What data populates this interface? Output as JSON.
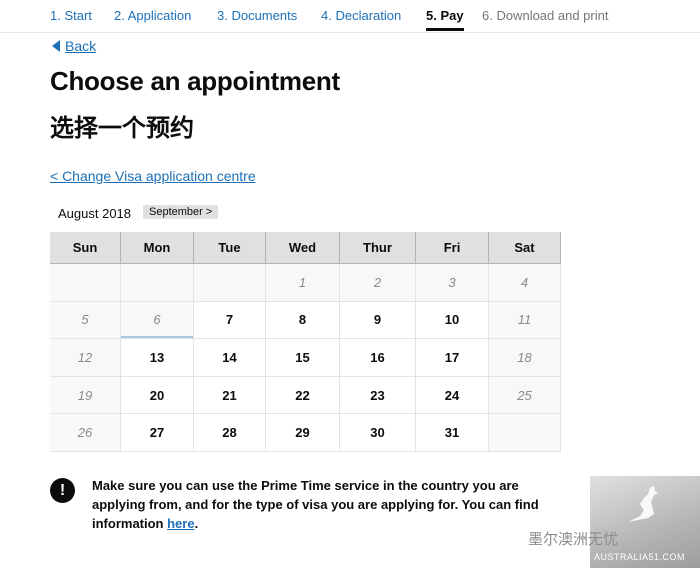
{
  "steps": [
    {
      "label": "1. Start",
      "state": "link"
    },
    {
      "label": "2. Application",
      "state": "link"
    },
    {
      "label": "3. Documents",
      "state": "link"
    },
    {
      "label": "4. Declaration",
      "state": "link"
    },
    {
      "label": "5. Pay",
      "state": "current"
    },
    {
      "label": "6. Download and print",
      "state": "disabled"
    }
  ],
  "back_label": "Back",
  "page_title": "Choose an appointment",
  "page_subtitle": "选择一个预约",
  "change_centre_label": "< Change Visa application centre",
  "calendar": {
    "month_label": "August 2018",
    "next_month_label": "September >",
    "day_headers": [
      "Sun",
      "Mon",
      "Tue",
      "Wed",
      "Thur",
      "Fri",
      "Sat"
    ],
    "weeks": [
      [
        "",
        "",
        "",
        "1",
        "2",
        "3",
        "4"
      ],
      [
        "5",
        "6",
        "7",
        "8",
        "9",
        "10",
        "11"
      ],
      [
        "12",
        "13",
        "14",
        "15",
        "16",
        "17",
        "18"
      ],
      [
        "19",
        "20",
        "21",
        "22",
        "23",
        "24",
        "25"
      ],
      [
        "26",
        "27",
        "28",
        "29",
        "30",
        "31",
        ""
      ]
    ],
    "available_days": [
      "7",
      "8",
      "9",
      "10",
      "13",
      "14",
      "15",
      "16",
      "17",
      "20",
      "21",
      "22",
      "23",
      "24",
      "27",
      "28",
      "29",
      "30",
      "31"
    ]
  },
  "warning": {
    "icon": "exclamation-icon",
    "text": "Make sure you can use the Prime Time service in the country you are applying from, and for the type of visa you are applying for. You can find information ",
    "link": "here",
    "end": "."
  },
  "watermark": {
    "brand": "AUSTRALIA51.COM",
    "chinese": "墨尔澳洲无忧"
  }
}
